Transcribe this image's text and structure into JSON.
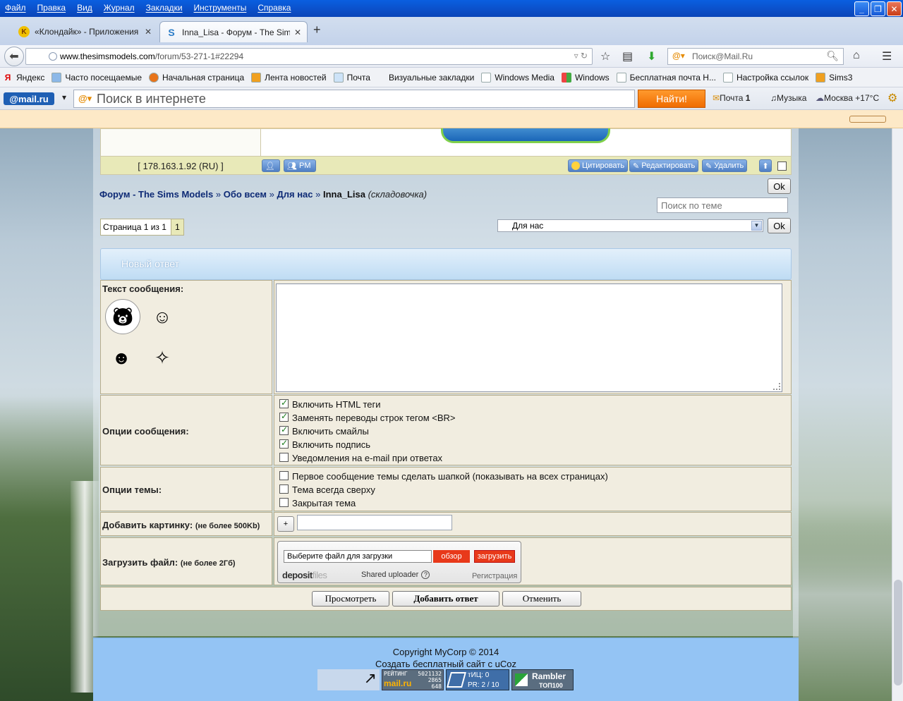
{
  "browser": {
    "menu": [
      "Файл",
      "Правка",
      "Вид",
      "Журнал",
      "Закладки",
      "Инструменты",
      "Справка"
    ],
    "tabs": [
      {
        "title": "«Клондайк» - Приложения - ...",
        "favicon": "K",
        "favicon_color": "#f0c000"
      },
      {
        "title": "Inna_Lisa - Форум - The Sims ...",
        "favicon": "S",
        "favicon_color": "#2a7cc7"
      }
    ],
    "new_tab": "+",
    "url_domain": "www.thesimsmodels.com",
    "url_path": "/forum/53-271-1#22294",
    "search_placeholder": "Поиск@Mail.Ru"
  },
  "bookmarks": [
    {
      "label": "Яндекс",
      "icon": "yandex-icon"
    },
    {
      "label": "Часто посещаемые",
      "icon": "folder-icon"
    },
    {
      "label": "Начальная страница",
      "icon": "firefox-icon"
    },
    {
      "label": "Лента новостей",
      "icon": "rss-icon"
    },
    {
      "label": "Почта",
      "icon": "mail-icon"
    },
    {
      "label": "Визуальные закладки",
      "icon": "bookmark-icon"
    },
    {
      "label": "Windows Media",
      "icon": "page-icon"
    },
    {
      "label": "Windows",
      "icon": "windows-icon"
    },
    {
      "label": "Бесплатная почта Н...",
      "icon": "page-icon"
    },
    {
      "label": "Настройка ссылок",
      "icon": "page-icon"
    },
    {
      "label": "Sims3",
      "icon": "rss-icon"
    }
  ],
  "mailru": {
    "logo": "@mail.ru",
    "search_placeholder": "Поиск в интернете",
    "find_button": "Найти!",
    "mail": "Почта",
    "mail_count": "1",
    "music": "Музыка",
    "weather": "Москва +17°C"
  },
  "post": {
    "ip": "[ 178.163.1.92 (RU) ]",
    "pm": "PM",
    "quote": "Цитировать",
    "edit": "Редактировать",
    "delete": "Удалить"
  },
  "breadcrumb": {
    "forum": "Форум - The Sims Models",
    "sep": "»",
    "section": "Обо всем",
    "subsection": "Для нас",
    "topic": "Inna_Lisa",
    "topic_note": "(складовочка)"
  },
  "controls": {
    "ok": "Ok",
    "topic_search_placeholder": "Поиск по теме",
    "page_label": "Страница 1 из 1",
    "page_current": "1",
    "jump_selected": "Для нас"
  },
  "form": {
    "title": "Новый ответ",
    "message_label": "Текст сообщения:",
    "message_options_label": "Опции сообщения:",
    "message_options": [
      {
        "label": "Включить HTML теги",
        "checked": true
      },
      {
        "label": "Заменять переводы строк тегом <BR>",
        "checked": true
      },
      {
        "label": "Включить смайлы",
        "checked": true
      },
      {
        "label": "Включить подпись",
        "checked": true
      },
      {
        "label": "Уведомления на e-mail при ответах",
        "checked": false
      }
    ],
    "topic_options_label": "Опции темы:",
    "topic_options": [
      {
        "label": "Первое сообщение темы сделать шапкой (показывать на всех страницах)",
        "checked": false
      },
      {
        "label": "Тема всегда сверху",
        "checked": false
      },
      {
        "label": "Закрытая тема",
        "checked": false
      }
    ],
    "add_image_label": "Добавить картинку:",
    "add_image_limit": "(не более 500Kb)",
    "add_image_button": "+",
    "upload_label": "Загрузить файл:",
    "upload_limit": "(не более 2Гб)",
    "uploader": {
      "input_text": "Выберите файл для загрузки",
      "browse": "обзор",
      "upload": "загрузить",
      "brand": "deposit",
      "brand_suffix": "files",
      "shared": "Shared uploader",
      "help": "?",
      "register": "Регистрация"
    },
    "preview_button": "Просмотреть",
    "submit_button": "Добавить ответ",
    "cancel_button": "Отменить"
  },
  "footer": {
    "copyright": "Copyright MyCorp © 2014",
    "ucoz": "Создать бесплатный сайт с uCoz",
    "mailru_rating_label": "РЕЙТИНГ",
    "mailru_rating_values": [
      "5021132",
      "2865",
      "648"
    ],
    "mailru_rating_brand": "mail.ru",
    "tic": "тИЦ: 0",
    "pr": "PR: 2 / 10",
    "rambler": "Rambler",
    "rambler_top": "ТОП100"
  }
}
